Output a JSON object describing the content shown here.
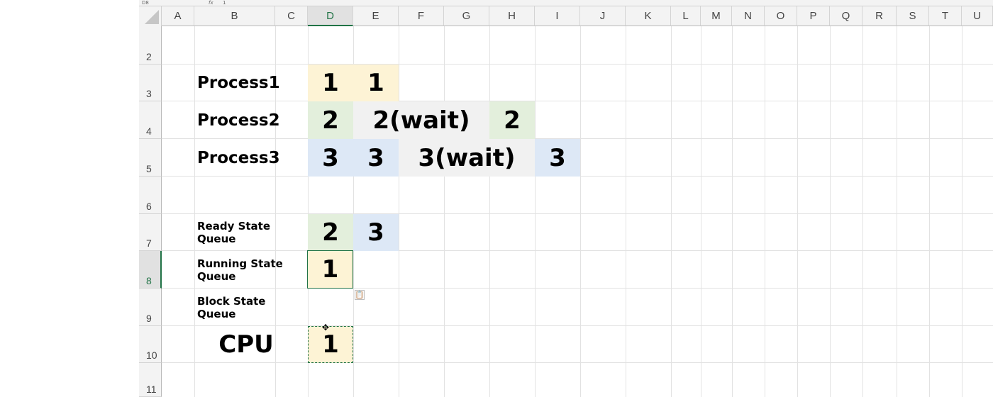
{
  "formula_bar": {
    "name_box": "D8",
    "fx": "fx",
    "value": "1"
  },
  "columns": [
    "A",
    "B",
    "C",
    "D",
    "E",
    "F",
    "G",
    "H",
    "I",
    "J",
    "K",
    "L",
    "M",
    "N",
    "O",
    "P",
    "Q",
    "R",
    "S",
    "T",
    "U"
  ],
  "rows": [
    "2",
    "3",
    "4",
    "5",
    "6",
    "7",
    "8",
    "9",
    "10",
    "11"
  ],
  "active_cell": {
    "column": "D",
    "row": "8"
  },
  "processes": [
    {
      "label": "Process1",
      "cells": [
        {
          "col": "D",
          "text": "1",
          "color": "yellow"
        },
        {
          "col": "E",
          "text": "1",
          "color": "yellow"
        }
      ]
    },
    {
      "label": "Process2",
      "cells": [
        {
          "col": "D",
          "text": "2",
          "color": "green"
        },
        {
          "col": "E-G",
          "text": "2(wait)",
          "color": "gray"
        },
        {
          "col": "H",
          "text": "2",
          "color": "green"
        }
      ]
    },
    {
      "label": "Process3",
      "cells": [
        {
          "col": "D",
          "text": "3",
          "color": "blue"
        },
        {
          "col": "E",
          "text": "3",
          "color": "blue"
        },
        {
          "col": "F-H",
          "text": "3(wait)",
          "color": "gray"
        },
        {
          "col": "I",
          "text": "3",
          "color": "blue"
        }
      ]
    }
  ],
  "queues": {
    "ready": {
      "label": "Ready State Queue",
      "values": [
        "2",
        "3"
      ]
    },
    "running": {
      "label": "Running State Queue",
      "values": [
        "1"
      ]
    },
    "block": {
      "label": "Block State Queue",
      "values": []
    }
  },
  "cpu": {
    "label": "CPU",
    "value": "1"
  },
  "colors": {
    "yellow": "#fdf3d5",
    "green": "#e3efdc",
    "blue": "#dde8f6",
    "gray": "#f1f1f1",
    "accent": "#217346"
  }
}
